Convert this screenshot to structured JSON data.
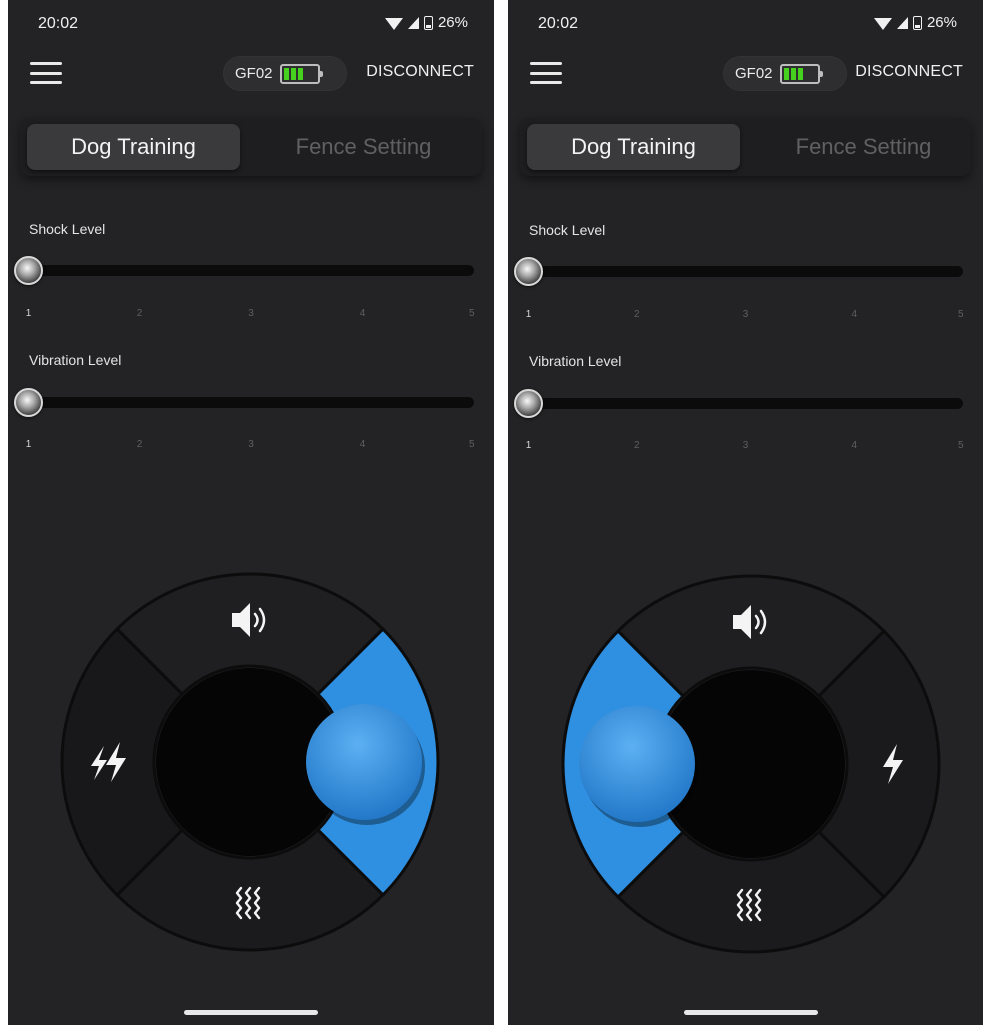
{
  "screens": [
    {
      "status_bar": {
        "time": "20:02",
        "battery_percent": "26%"
      },
      "app_bar": {
        "device_name": "GF02",
        "device_battery_bars": 3,
        "disconnect_label": "DISCONNECT"
      },
      "tabs": [
        {
          "label": "Dog Training",
          "active": true
        },
        {
          "label": "Fence Setting",
          "active": false
        }
      ],
      "shock_level": {
        "label": "Shock Level",
        "value": 1,
        "ticks": [
          "1",
          "2",
          "3",
          "4",
          "5"
        ]
      },
      "vibration_level": {
        "label": "Vibration Level",
        "value": 1,
        "ticks": [
          "1",
          "2",
          "3",
          "4",
          "5"
        ]
      },
      "remote": {
        "top_icon": "speaker-icon",
        "left_icon": "double-lightning-icon",
        "bottom_icon": "vibration-icon",
        "right_icon": "none",
        "pressed_segment": "right"
      }
    },
    {
      "status_bar": {
        "time": "20:02",
        "battery_percent": "26%"
      },
      "app_bar": {
        "device_name": "GF02",
        "device_battery_bars": 3,
        "disconnect_label": "DISCONNECT"
      },
      "tabs": [
        {
          "label": "Dog Training",
          "active": true
        },
        {
          "label": "Fence Setting",
          "active": false
        }
      ],
      "shock_level": {
        "label": "Shock Level",
        "value": 1,
        "ticks": [
          "1",
          "2",
          "3",
          "4",
          "5"
        ]
      },
      "vibration_level": {
        "label": "Vibration Level",
        "value": 1,
        "ticks": [
          "1",
          "2",
          "3",
          "4",
          "5"
        ]
      },
      "remote": {
        "top_icon": "speaker-icon",
        "left_icon": "none",
        "bottom_icon": "vibration-icon",
        "right_icon": "lightning-icon",
        "pressed_segment": "left"
      }
    }
  ],
  "colors": {
    "background": "#232325",
    "active_blue": "#2f8fe0",
    "battery_green": "#47d11f",
    "segment_dark": "#1c1c1e"
  }
}
